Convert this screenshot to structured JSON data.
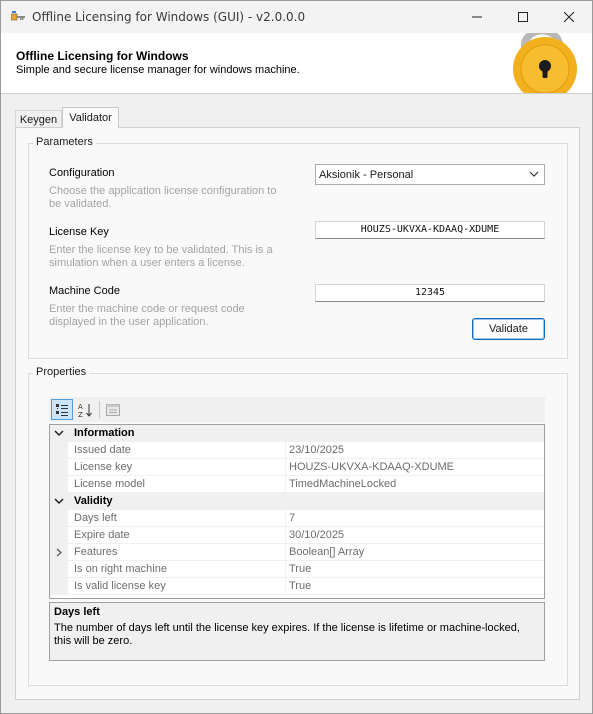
{
  "window": {
    "title": "Offline Licensing for Windows (GUI) - v2.0.0.0",
    "minimize_glyph": "—",
    "maximize_glyph": "☐",
    "close_glyph": "✕"
  },
  "banner": {
    "title": "Offline Licensing for Windows",
    "subtitle": "Simple and secure license manager for windows machine."
  },
  "tabs": [
    {
      "label": "Keygen",
      "selected": false
    },
    {
      "label": "Validator",
      "selected": true
    }
  ],
  "parameters": {
    "group_title": "Parameters",
    "configuration": {
      "label": "Configuration",
      "help": "Choose the application license configuration to be validated.",
      "value": "Aksionik - Personal"
    },
    "license_key": {
      "label": "License Key",
      "help": "Enter the license key to be validated. This is a simulation when a user enters a license.",
      "value": "HOUZS-UKVXA-KDAAQ-XDUME"
    },
    "machine_code": {
      "label": "Machine Code",
      "help": "Enter the machine code or request code displayed in the user application.",
      "value": "12345"
    },
    "validate_label": "Validate"
  },
  "properties": {
    "group_title": "Properties",
    "categories": [
      {
        "name": "Information",
        "rows": [
          {
            "name": "Issued date",
            "value": "23/10/2025"
          },
          {
            "name": "License key",
            "value": "HOUZS-UKVXA-KDAAQ-XDUME"
          },
          {
            "name": "License model",
            "value": "TimedMachineLocked"
          }
        ]
      },
      {
        "name": "Validity",
        "rows": [
          {
            "name": "Days left",
            "value": "7"
          },
          {
            "name": "Expire date",
            "value": "30/10/2025"
          },
          {
            "name": "Features",
            "value": "Boolean[] Array"
          },
          {
            "name": "Is on right machine",
            "value": "True"
          },
          {
            "name": "Is valid license key",
            "value": "True"
          }
        ]
      }
    ],
    "help": {
      "title": "Days left",
      "description": "The number of days left until the license key expires. If the license is lifetime or machine-locked, this will be zero."
    }
  },
  "colors": {
    "accent": "#0f6cbd",
    "lock_gold": "#f2b01e",
    "lock_shackle": "#b5b5b5"
  },
  "icons": [
    "app-key-icon",
    "lock-icon",
    "chevron-down-icon",
    "categorized-icon",
    "alphabetical-sort-icon",
    "property-pages-icon"
  ]
}
